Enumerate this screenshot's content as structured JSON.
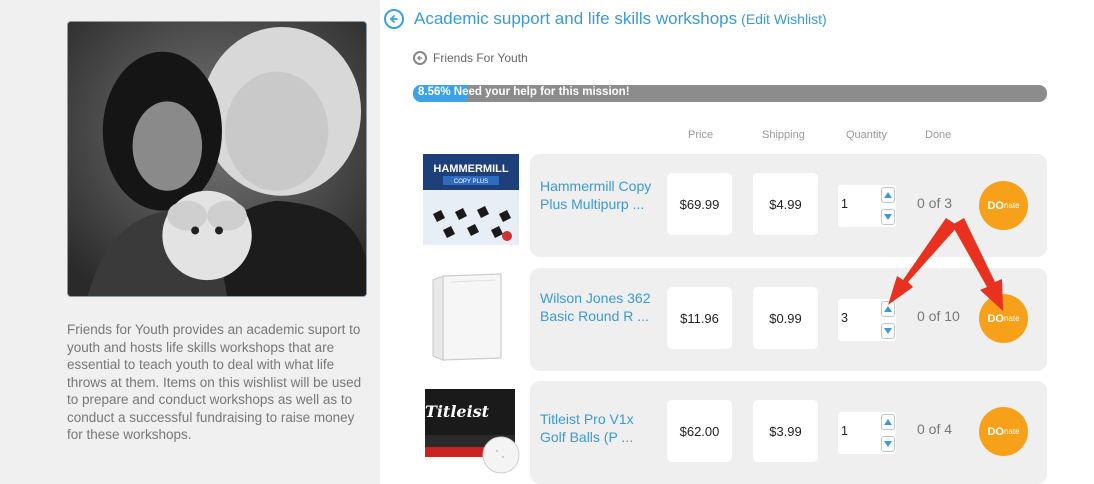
{
  "wishlist": {
    "title": "Academic support and life skills workshops",
    "edit_label": "(Edit Wishlist)",
    "organization": "Friends For Youth",
    "progress_percent": 8.56,
    "progress_text": "8.56% Need your help for this mission!",
    "description": "Friends for Youth provides an academic suport to youth and hosts life skills workshops that are essential to teach youth to deal with what life throws at them. Items on this wishlist will be used to prepare and conduct workshops as well as to conduct a successful fundraising to raise money for these workshops."
  },
  "columns": {
    "price": "Price",
    "shipping": "Shipping",
    "quantity": "Quantity",
    "done": "Done"
  },
  "items": [
    {
      "name": "Hammermill Copy Plus Multipurp ...",
      "price": "$69.99",
      "shipping": "$4.99",
      "quantity": "1",
      "done": "0 of 3",
      "donate_big": "DO",
      "donate_small": "nate",
      "thumb_brand": "HAMMERMILL",
      "thumb_sub": "COPY PLUS"
    },
    {
      "name": "Wilson Jones 362 Basic Round R ...",
      "price": "$11.96",
      "shipping": "$0.99",
      "quantity": "3",
      "done": "0 of 10",
      "donate_big": "DO",
      "donate_small": "nate"
    },
    {
      "name": "Titleist Pro V1x Golf Balls (P ...",
      "price": "$62.00",
      "shipping": "$3.99",
      "quantity": "1",
      "done": "0 of 4",
      "donate_big": "DO",
      "donate_small": "nate",
      "thumb_brand": "Titleist"
    }
  ],
  "colors": {
    "accent": "#3a9ad9",
    "donate": "#f7a11a",
    "annotation_arrow": "#e8321f"
  },
  "icons": {
    "title": "collapse-circle-icon",
    "organization": "organization-icon",
    "spin_up": "arrow-up-icon",
    "spin_down": "arrow-down-icon"
  }
}
